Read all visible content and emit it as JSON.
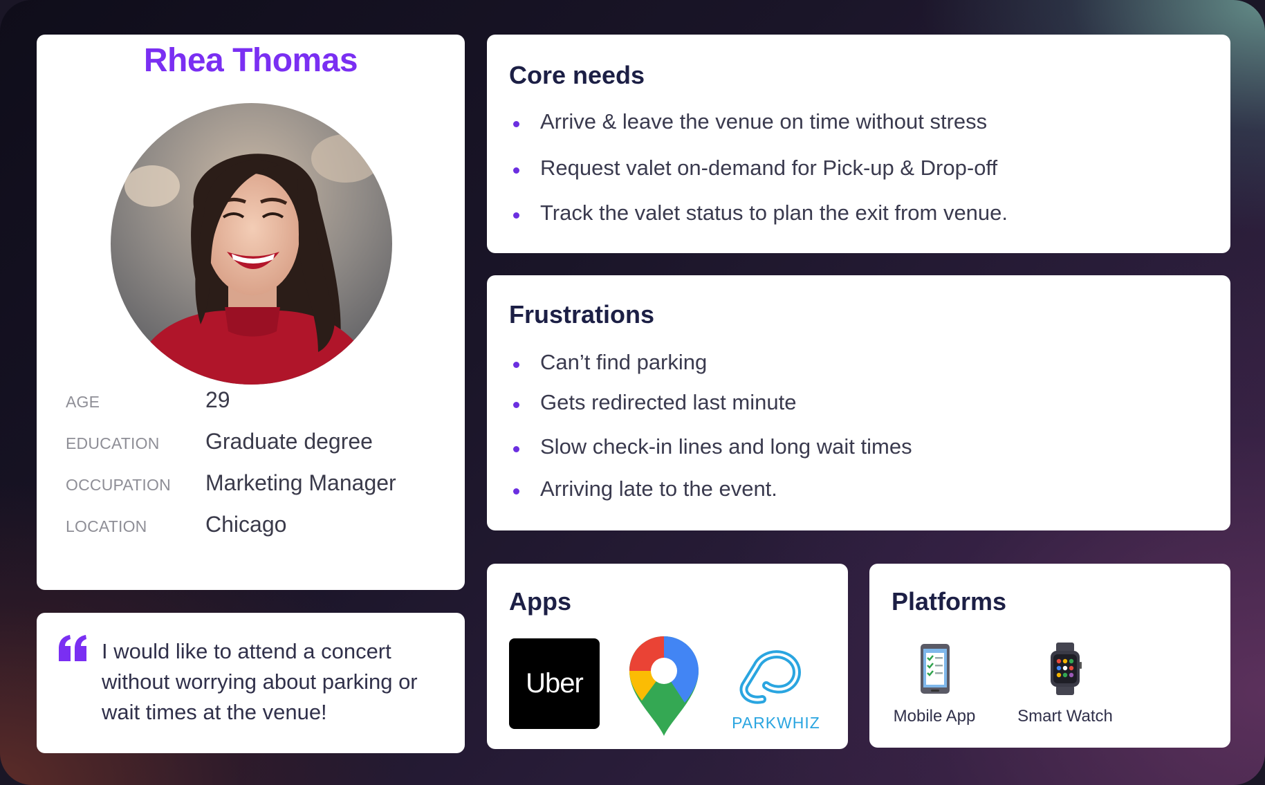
{
  "persona": {
    "name": "Rhea Thomas",
    "attributes": [
      {
        "label": "AGE",
        "value": "29"
      },
      {
        "label": "EDUCATION",
        "value": "Graduate degree"
      },
      {
        "label": "OCCUPATION",
        "value": "Marketing Manager"
      },
      {
        "label": "LOCATION",
        "value": "Chicago"
      }
    ],
    "quote": "I would like to attend a concert without worrying about parking or wait times at the venue!"
  },
  "core_needs": {
    "title": "Core needs",
    "items": [
      "Arrive & leave the venue on time without stress",
      "Request valet on-demand for Pick-up & Drop-off",
      "Track the valet status to plan the exit from venue."
    ]
  },
  "frustrations": {
    "title": "Frustrations",
    "items": [
      "Can’t find parking",
      "Gets redirected last minute",
      "Slow check-in lines and long wait times",
      "Arriving late to the event."
    ]
  },
  "apps": {
    "title": "Apps",
    "logos": [
      {
        "icon": "uber-logo",
        "text": "Uber"
      },
      {
        "icon": "google-maps-icon"
      },
      {
        "icon": "parkwhiz-logo",
        "text": "PARKWHIZ"
      }
    ]
  },
  "platforms": {
    "title": "Platforms",
    "items": [
      {
        "icon": "mobile-app-icon",
        "label": "Mobile App"
      },
      {
        "icon": "smart-watch-icon",
        "label": "Smart Watch"
      }
    ]
  },
  "colors": {
    "accent": "#7a2ff2",
    "bullet": "#6b2fe0",
    "heading": "#1c1f45",
    "label_gray": "#8e8e96"
  }
}
